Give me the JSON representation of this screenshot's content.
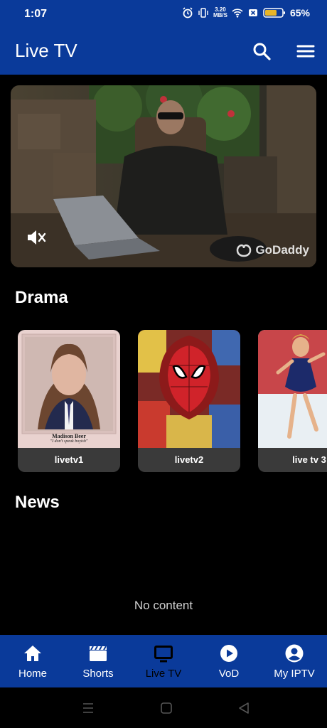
{
  "status_bar": {
    "time": "1:07",
    "speed_value": "3.20",
    "speed_unit": "MB/S",
    "battery": "65%",
    "icons": [
      "alarm-icon",
      "vibrate-icon",
      "wifi-icon",
      "sim-off-icon",
      "battery-icon"
    ]
  },
  "app_bar": {
    "title": "Live TV",
    "icons": [
      "search-icon",
      "menu-icon"
    ]
  },
  "video": {
    "brand_text": "GoDaddy",
    "icons": [
      "mute-icon"
    ]
  },
  "sections": {
    "drama": {
      "title": "Drama",
      "items": [
        {
          "label": "livetv1",
          "thumb_text": "Madison Beer",
          "thumb_subtext": "\"I don't speak boyish\""
        },
        {
          "label": "livetv2"
        },
        {
          "label": "live tv 3"
        }
      ]
    },
    "news": {
      "title": "News",
      "empty_text": "No content"
    }
  },
  "bottom_nav": {
    "items": [
      {
        "label": "Home",
        "icon": "home-icon"
      },
      {
        "label": "Shorts",
        "icon": "clapper-icon"
      },
      {
        "label": "Live TV",
        "icon": "tv-icon",
        "active": true
      },
      {
        "label": "VoD",
        "icon": "play-icon"
      },
      {
        "label": "My IPTV",
        "icon": "account-icon"
      }
    ]
  },
  "colors": {
    "primary": "#0a3a9a",
    "background": "#000000",
    "card_bg": "#3a3a3a",
    "battery_fill": "#e8b528"
  }
}
